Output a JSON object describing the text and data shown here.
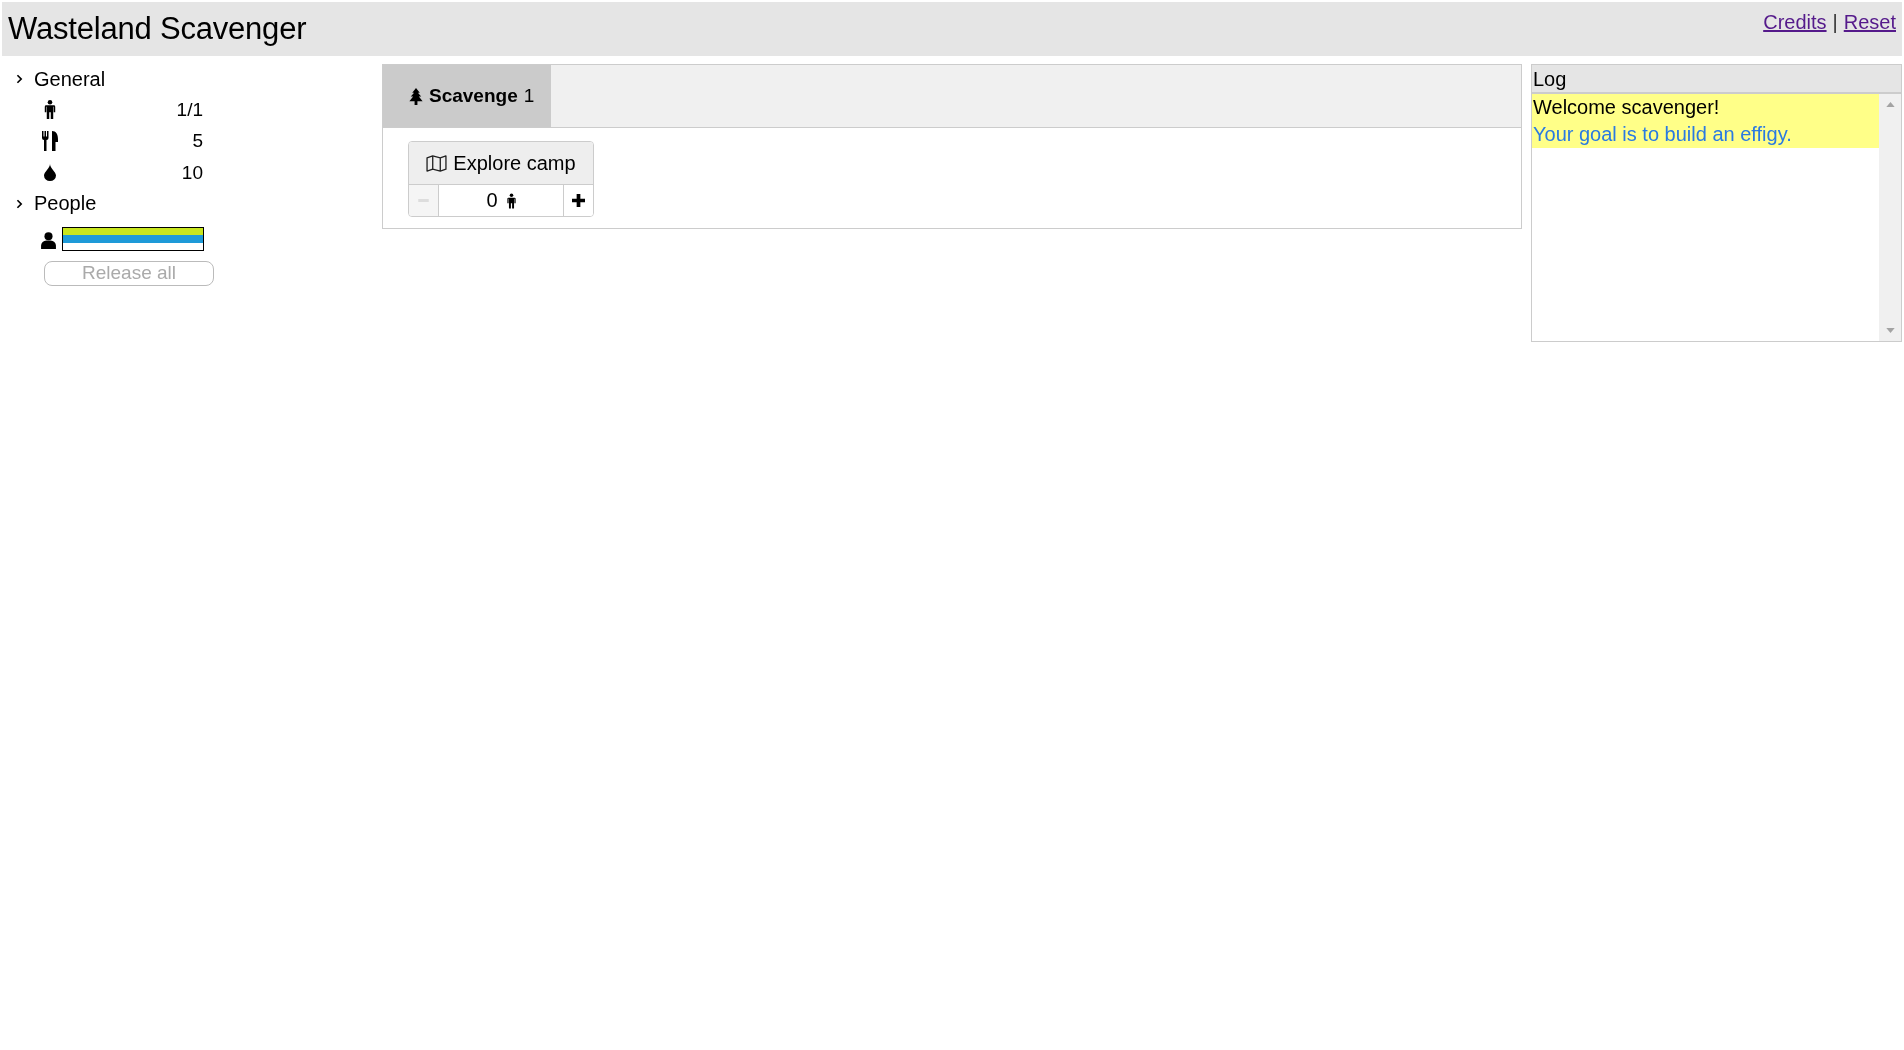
{
  "header": {
    "title": "Wasteland Scavenger",
    "links": [
      {
        "label": "Credits"
      },
      {
        "label": "Reset"
      }
    ],
    "separator": "|"
  },
  "sidebar": {
    "general": {
      "title": "General",
      "stats": [
        {
          "kind": "people",
          "value": "1/1"
        },
        {
          "kind": "food",
          "value": "5"
        },
        {
          "kind": "water",
          "value": "10"
        }
      ]
    },
    "people": {
      "title": "People",
      "members": [
        {
          "bars": [
            {
              "level": 1,
              "color": "#c8e61e"
            },
            {
              "level": 1,
              "color": "#1e9ad8"
            }
          ]
        }
      ],
      "release_button": {
        "label": "Release all",
        "disabled": true
      }
    }
  },
  "tabs": [
    {
      "label": "Scavenge",
      "count": "1",
      "selected": true
    }
  ],
  "actions": [
    {
      "label": "Explore camp",
      "workers": "0",
      "decrease": {
        "disabled": true
      },
      "increase": {
        "disabled": false
      }
    }
  ],
  "log": {
    "title": "Log",
    "entries": [
      {
        "text": "Welcome scavenger!",
        "kind": "message",
        "highlighted": true
      },
      {
        "text": "Your goal is to build an effigy.",
        "kind": "hint",
        "highlighted": true
      }
    ]
  }
}
